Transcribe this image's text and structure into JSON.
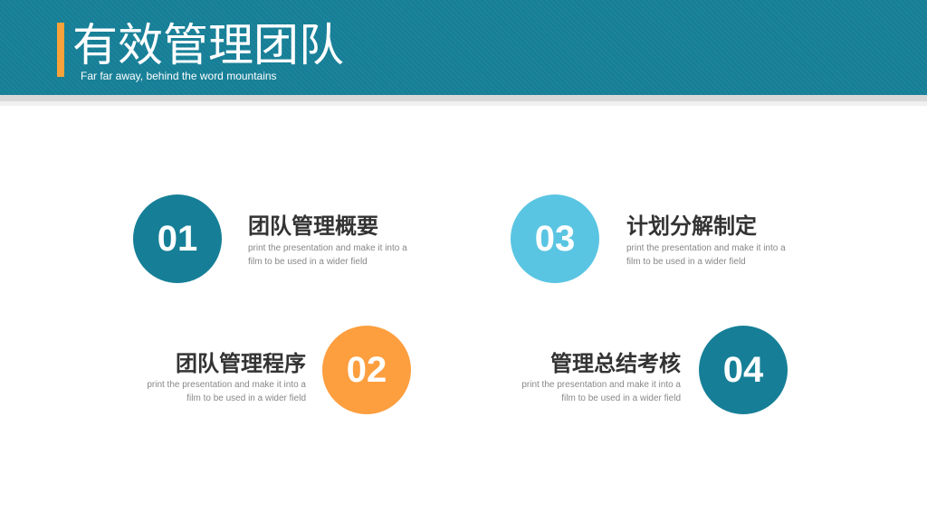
{
  "header": {
    "title": "有效管理团队",
    "subtitle": "Far far away, behind the word mountains"
  },
  "colors": {
    "header_bg": "#167f97",
    "accent": "#f7a23a",
    "circle_dark": "#167f97",
    "circle_light": "#5ac5e2",
    "circle_orange": "#fd9e3f"
  },
  "items": [
    {
      "number": "01",
      "title": "团队管理概要",
      "desc_line1": "print the presentation and make it into a",
      "desc_line2": "film to be used in a wider field"
    },
    {
      "number": "02",
      "title": "团队管理程序",
      "desc_line1": "print the presentation and make it into a",
      "desc_line2": "film to be used in a wider field"
    },
    {
      "number": "03",
      "title": "计划分解制定",
      "desc_line1": "print the presentation and make it into a",
      "desc_line2": "film to be used in a wider field"
    },
    {
      "number": "04",
      "title": "管理总结考核",
      "desc_line1": "print the presentation and make it into a",
      "desc_line2": "film to be used in a wider field"
    }
  ]
}
